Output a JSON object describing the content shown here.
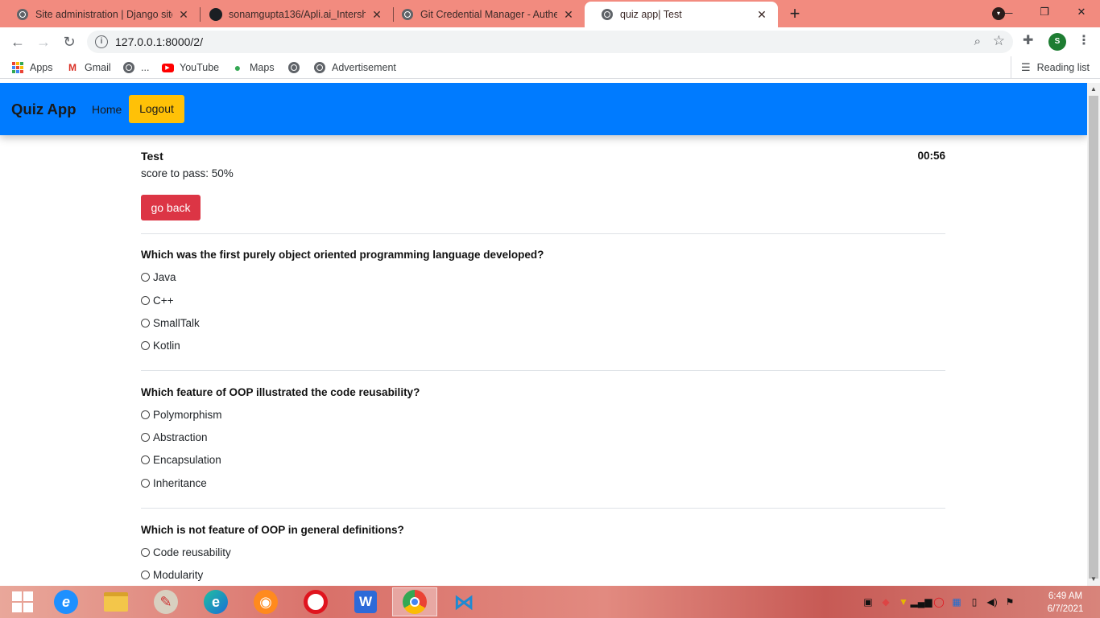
{
  "browser": {
    "tabs": [
      {
        "title": "Site administration | Django site admin",
        "close": "✕"
      },
      {
        "title": "sonamgupta136/Apli.ai_Intership",
        "close": "✕"
      },
      {
        "title": "Git Credential Manager - Authentication",
        "close": "✕"
      },
      {
        "title": "quiz app| Test",
        "close": "✕"
      }
    ],
    "new_tab": "+",
    "url": "127.0.0.1:8000/2/",
    "profile_initial": "S",
    "bookmarks": {
      "apps": "Apps",
      "gmail": "Gmail",
      "ellipsis": "...",
      "youtube": "YouTube",
      "maps": "Maps",
      "advertisement": "Advertisement"
    },
    "reading_list": "Reading list"
  },
  "navbar": {
    "brand": "Quiz App",
    "home": "Home",
    "logout": "Logout"
  },
  "quiz": {
    "name": "Test",
    "timer": "00:56",
    "pass_text": "score to pass: 50%",
    "go_back": "go back",
    "questions": [
      {
        "text": "Which was the first purely object oriented programming language developed?",
        "options": [
          "Java",
          "C++",
          "SmallTalk",
          "Kotlin"
        ]
      },
      {
        "text": "Which feature of OOP illustrated the code reusability?",
        "options": [
          "Polymorphism",
          "Abstraction",
          "Encapsulation",
          "Inheritance"
        ]
      },
      {
        "text": "Which is not feature of OOP in general definitions?",
        "options": [
          "Code reusability",
          "Modularity"
        ]
      }
    ]
  },
  "taskbar": {
    "time": "6:49 AM",
    "date": "6/7/2021"
  },
  "colors": {
    "navbar": "#007bff",
    "logout": "#ffc107",
    "go_back": "#dc3545",
    "tabstrip": "#f28b7f"
  }
}
